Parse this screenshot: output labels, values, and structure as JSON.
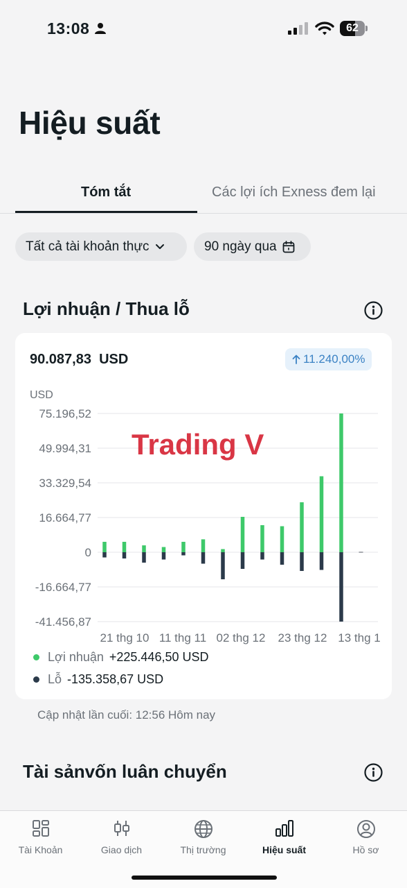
{
  "status_bar": {
    "time": "13:08",
    "battery": "62",
    "battery_level": 0.62
  },
  "page_title": "Hiệu suất",
  "tabs": [
    {
      "label": "Tóm tắt",
      "active": true
    },
    {
      "label": "Các lợi ích Exness đem lại",
      "active": false
    }
  ],
  "filters": {
    "accounts": "Tất cả tài khoản thực",
    "period": "90 ngày qua"
  },
  "pnl_section": {
    "title": "Lợi nhuận / Thua lỗ",
    "balance": "90.087,83",
    "currency": "USD",
    "change": "11.240,00%",
    "y_unit": "USD",
    "watermark": "Trading V",
    "legend": [
      {
        "name": "Lợi nhuận",
        "value": "+225.446,50",
        "unit": "USD",
        "color": "#3ec96a"
      },
      {
        "name": "Lỗ",
        "value": "-135.358,67",
        "unit": "USD",
        "color": "#2b3a4a"
      }
    ],
    "updated": "Cập nhật lần cuối: 12:56 Hôm nay"
  },
  "chart_data": {
    "type": "bar",
    "y_ticks": [
      "75.196,52",
      "49.994,31",
      "33.329,54",
      "16.664,77",
      "0",
      "-16.664,77",
      "-41.456,87"
    ],
    "x_tick_labels": [
      "21 thg 10",
      "11 thg 11",
      "02 thg 12",
      "23 thg 12",
      "13 thg 1"
    ],
    "series": [
      {
        "name": "Lợi nhuận",
        "color": "#3ec96a",
        "values": [
          5000,
          5000,
          3300,
          2500,
          5000,
          6200,
          1500,
          17000,
          13000,
          12500,
          24000,
          36500,
          75196.52,
          0
        ]
      },
      {
        "name": "Lỗ",
        "color": "#2b3a4a",
        "values": [
          -2500,
          -3000,
          -5000,
          -3500,
          -1500,
          -5500,
          -13000,
          -8000,
          -3500,
          -6000,
          -9000,
          -8500,
          -41456.87,
          0
        ]
      }
    ]
  },
  "assets_section": {
    "title": "Tài sảnvốn luân chuyển"
  },
  "tabbar": [
    {
      "label": "Tài Khoản",
      "icon": "grid-icon",
      "active": false
    },
    {
      "label": "Giao dịch",
      "icon": "candlestick-icon",
      "active": false
    },
    {
      "label": "Thị trường",
      "icon": "globe-icon",
      "active": false
    },
    {
      "label": "Hiệu suất",
      "icon": "bar-chart-icon",
      "active": true
    },
    {
      "label": "Hồ sơ",
      "icon": "profile-icon",
      "active": false
    }
  ]
}
